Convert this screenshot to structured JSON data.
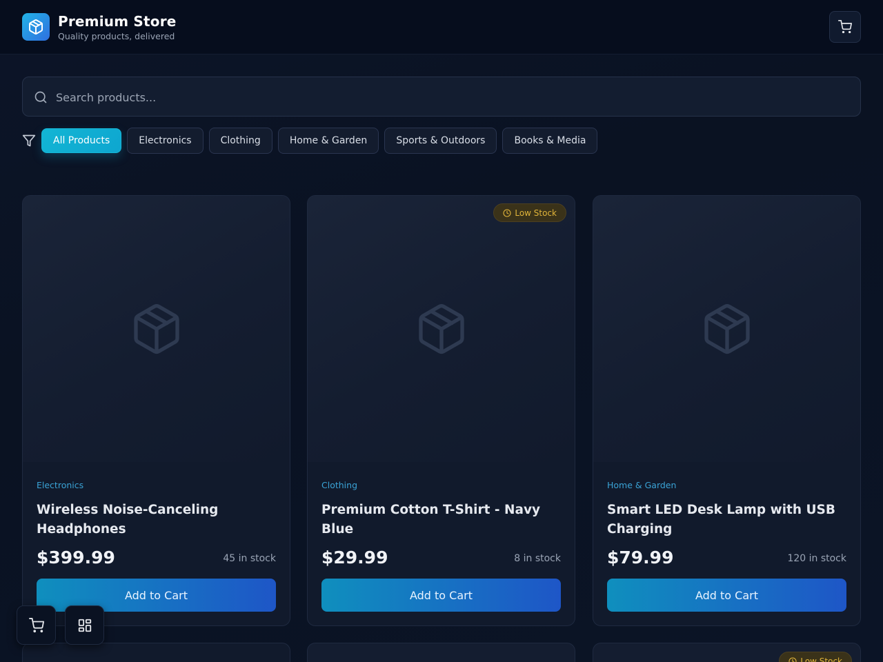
{
  "header": {
    "title": "Premium Store",
    "subtitle": "Quality products, delivered"
  },
  "search": {
    "placeholder": "Search products...",
    "value": ""
  },
  "filters": {
    "categories": [
      "All Products",
      "Electronics",
      "Clothing",
      "Home & Garden",
      "Sports & Outdoors",
      "Books & Media"
    ],
    "active": "All Products"
  },
  "products": [
    {
      "category": "Electronics",
      "name": "Wireless Noise-Canceling Headphones",
      "price": "$399.99",
      "stock": "45 in stock",
      "badge": "",
      "button": "Add to Cart"
    },
    {
      "category": "Clothing",
      "name": "Premium Cotton T-Shirt - Navy Blue",
      "price": "$29.99",
      "stock": "8 in stock",
      "badge": "Low Stock",
      "button": "Add to Cart"
    },
    {
      "category": "Home & Garden",
      "name": "Smart LED Desk Lamp with USB Charging",
      "price": "$79.99",
      "stock": "120 in stock",
      "badge": "",
      "button": "Add to Cart"
    }
  ],
  "next_row_badge": "Low Stock",
  "colors": {
    "accent": "#0ea6d0",
    "background": "#0b1324",
    "badge_text": "#e0b43a",
    "category_text": "#3aa3d6"
  },
  "icons": [
    "package-icon",
    "cart-icon",
    "search-icon",
    "filter-icon",
    "clock-icon",
    "grid-icon"
  ]
}
